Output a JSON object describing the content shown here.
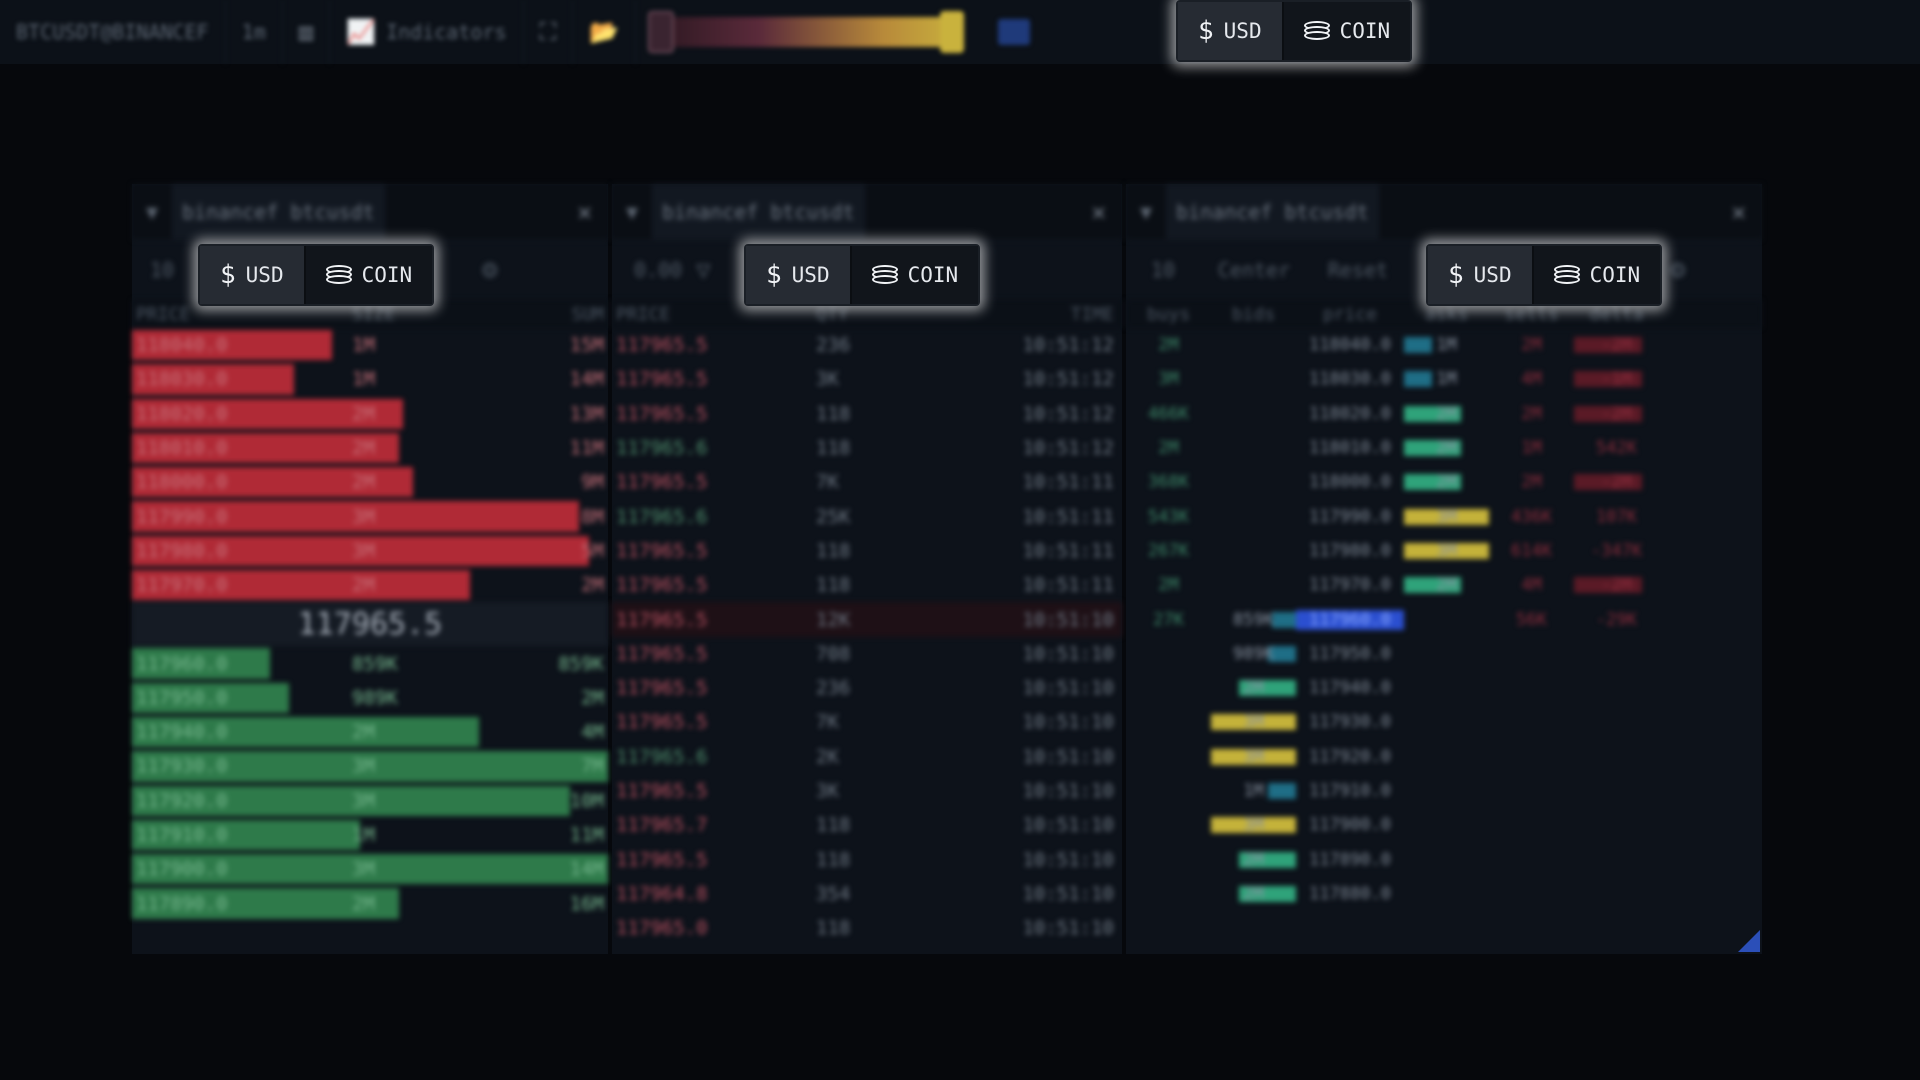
{
  "toolbar": {
    "symbol": "BTCUSDT@BINANCEF",
    "timeframe": "1m",
    "indicators_label": "Indicators",
    "currency_toggle": {
      "usd_label": "USD",
      "coin_label": "COIN",
      "usd_symbol": "$"
    }
  },
  "orderbook": {
    "title": "binancef btcusdt",
    "depth": "10",
    "columns": {
      "price": "PRICE",
      "size": "SIZE",
      "sum": "SUM"
    },
    "asks": [
      {
        "price": "118040.0",
        "size": "1M",
        "sum": "15M",
        "level": 0.42
      },
      {
        "price": "118030.0",
        "size": "1M",
        "sum": "14M",
        "level": 0.34
      },
      {
        "price": "118020.0",
        "size": "2M",
        "sum": "13M",
        "level": 0.57
      },
      {
        "price": "118010.0",
        "size": "2M",
        "sum": "11M",
        "level": 0.56
      },
      {
        "price": "118000.0",
        "size": "2M",
        "sum": "9M",
        "level": 0.59
      },
      {
        "price": "117990.0",
        "size": "3M",
        "sum": "8M",
        "level": 0.94
      },
      {
        "price": "117980.0",
        "size": "3M",
        "sum": "5M",
        "level": 0.96
      },
      {
        "price": "117970.0",
        "size": "2M",
        "sum": "2M",
        "level": 0.71
      }
    ],
    "mid_price": "117965.5",
    "bids": [
      {
        "price": "117960.0",
        "size": "859K",
        "sum": "859K",
        "level": 0.29
      },
      {
        "price": "117950.0",
        "size": "989K",
        "sum": "2M",
        "level": 0.33
      },
      {
        "price": "117940.0",
        "size": "2M",
        "sum": "4M",
        "level": 0.73
      },
      {
        "price": "117930.0",
        "size": "3M",
        "sum": "7M",
        "level": 1.0
      },
      {
        "price": "117920.0",
        "size": "3M",
        "sum": "10M",
        "level": 0.92
      },
      {
        "price": "117910.0",
        "size": "1M",
        "sum": "11M",
        "level": 0.48
      },
      {
        "price": "117900.0",
        "size": "3M",
        "sum": "14M",
        "level": 1.0
      },
      {
        "price": "117890.0",
        "size": "2M",
        "sum": "16M",
        "level": 0.56
      }
    ]
  },
  "trades": {
    "title": "binancef btcusdt",
    "filter_value": "0.00",
    "columns": {
      "price": "PRICE",
      "qty": "QTY",
      "time": "TIME"
    },
    "rows": [
      {
        "price": "117965.5",
        "qty": "236",
        "time": "10:51:12",
        "side": "sell"
      },
      {
        "price": "117965.5",
        "qty": "3K",
        "time": "10:51:12",
        "side": "sell"
      },
      {
        "price": "117965.5",
        "qty": "118",
        "time": "10:51:12",
        "side": "sell"
      },
      {
        "price": "117965.6",
        "qty": "118",
        "time": "10:51:12",
        "side": "buy"
      },
      {
        "price": "117965.5",
        "qty": "7K",
        "time": "10:51:11",
        "side": "sell"
      },
      {
        "price": "117965.6",
        "qty": "25K",
        "time": "10:51:11",
        "side": "buy"
      },
      {
        "price": "117965.5",
        "qty": "118",
        "time": "10:51:11",
        "side": "sell"
      },
      {
        "price": "117965.5",
        "qty": "118",
        "time": "10:51:11",
        "side": "sell"
      },
      {
        "price": "117965.5",
        "qty": "12K",
        "time": "10:51:10",
        "side": "sell"
      },
      {
        "price": "117965.5",
        "qty": "708",
        "time": "10:51:10",
        "side": "sell"
      },
      {
        "price": "117965.5",
        "qty": "236",
        "time": "10:51:10",
        "side": "sell"
      },
      {
        "price": "117965.5",
        "qty": "7K",
        "time": "10:51:10",
        "side": "sell"
      },
      {
        "price": "117965.6",
        "qty": "2K",
        "time": "10:51:10",
        "side": "buy"
      },
      {
        "price": "117965.5",
        "qty": "3K",
        "time": "10:51:10",
        "side": "sell"
      },
      {
        "price": "117965.7",
        "qty": "118",
        "time": "10:51:10",
        "side": "sell"
      },
      {
        "price": "117965.5",
        "qty": "118",
        "time": "10:51:10",
        "side": "sell"
      },
      {
        "price": "117964.8",
        "qty": "354",
        "time": "10:51:10",
        "side": "sell"
      },
      {
        "price": "117965.0",
        "qty": "118",
        "time": "10:51:10",
        "side": "sell"
      }
    ]
  },
  "ladder": {
    "title": "binancef btcusdt",
    "depth": "10",
    "center_label": "Center",
    "reset_label": "Reset",
    "columns": {
      "buys": "buys",
      "bids": "bids",
      "price": "price",
      "asks": "asks",
      "sells": "sells",
      "delta": "delta"
    },
    "rows": [
      {
        "buys": "2M",
        "bids": "",
        "price": "118040.0",
        "asks": "1M",
        "sells": "2M",
        "delta": "-2M"
      },
      {
        "buys": "3M",
        "bids": "",
        "price": "118030.0",
        "asks": "1M",
        "sells": "4M",
        "delta": "-1M"
      },
      {
        "buys": "466K",
        "bids": "",
        "price": "118020.0",
        "asks": "2M",
        "sells": "2M",
        "delta": "-2M"
      },
      {
        "buys": "2M",
        "bids": "",
        "price": "118010.0",
        "asks": "2M",
        "sells": "1M",
        "delta": "542K"
      },
      {
        "buys": "368K",
        "bids": "",
        "price": "118000.0",
        "asks": "2M",
        "sells": "2M",
        "delta": "-2M"
      },
      {
        "buys": "543K",
        "bids": "",
        "price": "117990.0",
        "asks": "3M",
        "sells": "436K",
        "delta": "107K"
      },
      {
        "buys": "267K",
        "bids": "",
        "price": "117980.0",
        "asks": "3M",
        "sells": "614K",
        "delta": "-347K"
      },
      {
        "buys": "2M",
        "bids": "",
        "price": "117970.0",
        "asks": "2M",
        "sells": "4M",
        "delta": "-2M"
      },
      {
        "buys": "27K",
        "bids": "859K",
        "price": "117960.0",
        "asks": "",
        "sells": "56K",
        "delta": "-29K"
      },
      {
        "buys": "",
        "bids": "989K",
        "price": "117950.0",
        "asks": "",
        "sells": "",
        "delta": ""
      },
      {
        "buys": "",
        "bids": "2M",
        "price": "117940.0",
        "asks": "",
        "sells": "",
        "delta": ""
      },
      {
        "buys": "",
        "bids": "3M",
        "price": "117930.0",
        "asks": "",
        "sells": "",
        "delta": ""
      },
      {
        "buys": "",
        "bids": "3M",
        "price": "117920.0",
        "asks": "",
        "sells": "",
        "delta": ""
      },
      {
        "buys": "",
        "bids": "1M",
        "price": "117910.0",
        "asks": "",
        "sells": "",
        "delta": ""
      },
      {
        "buys": "",
        "bids": "3M",
        "price": "117900.0",
        "asks": "",
        "sells": "",
        "delta": ""
      },
      {
        "buys": "",
        "bids": "2M",
        "price": "117890.0",
        "asks": "",
        "sells": "",
        "delta": ""
      },
      {
        "buys": "",
        "bids": "2M",
        "price": "117880.0",
        "asks": "",
        "sells": "",
        "delta": ""
      }
    ]
  },
  "colors": {
    "ask_bar": "#b02a36",
    "bid_bar": "#2e7a4a",
    "volume_high": "#c4b23a",
    "volume_mid": "#2fa37a",
    "volume_low": "#1f6e86",
    "mid_highlight": "#2b4fd0"
  }
}
